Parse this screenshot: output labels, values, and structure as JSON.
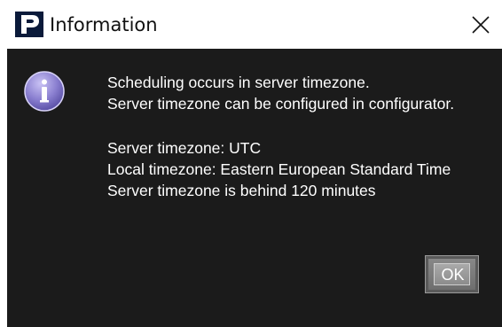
{
  "window": {
    "title": "Information",
    "logo_icon": "p-logo-icon",
    "close_icon": "close-icon"
  },
  "dialog": {
    "icon": "info-icon",
    "message_lines_1": [
      "Scheduling occurs in server timezone.",
      "Server timezone can be configured in configurator."
    ],
    "message_lines_2": [
      "Server timezone: UTC",
      "Local timezone: Eastern European Standard Time",
      "Server timezone is behind 120 minutes"
    ],
    "ok_label": "OK"
  },
  "colors": {
    "dialog_background": "#1b1b1b",
    "text": "#ffffff",
    "logo_background": "#0a1a3a",
    "icon_purple": "#8a7fd0"
  }
}
